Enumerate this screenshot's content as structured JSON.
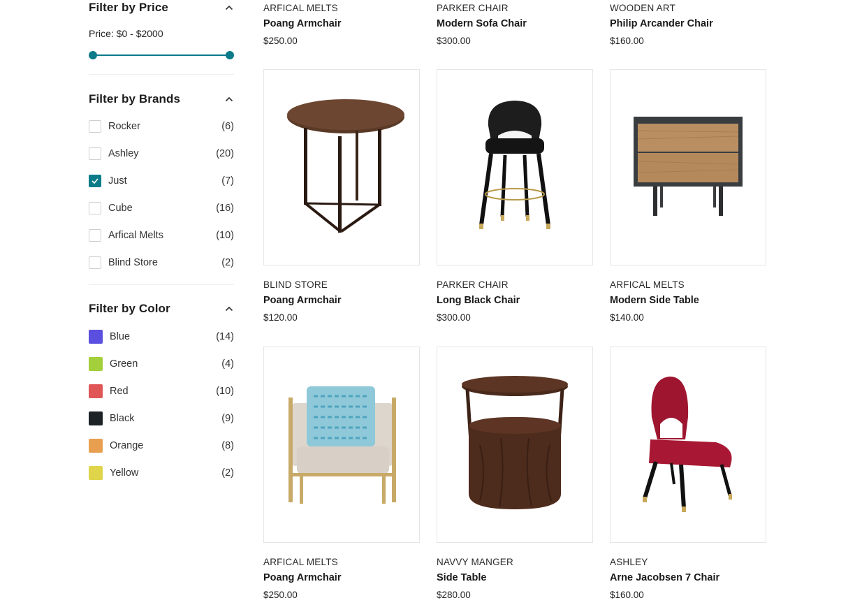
{
  "filters": {
    "price": {
      "title": "Filter by Price",
      "range_text": "Price: $0 - $2000",
      "min": 0,
      "max": 2000,
      "selected_min": 0,
      "selected_max": 2000
    },
    "brands": {
      "title": "Filter by Brands",
      "items": [
        {
          "label": "Rocker",
          "count": "(6)",
          "checked": false
        },
        {
          "label": "Ashley",
          "count": "(20)",
          "checked": false
        },
        {
          "label": "Just",
          "count": "(7)",
          "checked": true
        },
        {
          "label": "Cube",
          "count": "(16)",
          "checked": false
        },
        {
          "label": "Arfical Melts",
          "count": "(10)",
          "checked": false
        },
        {
          "label": "Blind Store",
          "count": "(2)",
          "checked": false
        }
      ]
    },
    "colors": {
      "title": "Filter by Color",
      "items": [
        {
          "label": "Blue",
          "count": "(14)",
          "color": "#5b4fe0"
        },
        {
          "label": "Green",
          "count": "(4)",
          "color": "#a3cf3a"
        },
        {
          "label": "Red",
          "count": "(10)",
          "color": "#e05555"
        },
        {
          "label": "Black",
          "count": "(9)",
          "color": "#1c2226"
        },
        {
          "label": "Orange",
          "count": "(8)",
          "color": "#e8a050"
        },
        {
          "label": "Yellow",
          "count": "(2)",
          "color": "#e0d44a"
        }
      ]
    }
  },
  "products": {
    "top_row": [
      {
        "brand": "ARFICAL MELTS",
        "name": "Poang Armchair",
        "price": "$250.00"
      },
      {
        "brand": "PARKER CHAIR",
        "name": "Modern Sofa Chair",
        "price": "$300.00"
      },
      {
        "brand": "WOODEN ART",
        "name": "Philip Arcander Chair",
        "price": "$160.00"
      }
    ],
    "row1": [
      {
        "brand": "BLIND STORE",
        "name": "Poang Armchair",
        "price": "$120.00",
        "image": "round-side-table"
      },
      {
        "brand": "PARKER CHAIR",
        "name": "Long Black Chair",
        "price": "$300.00",
        "image": "bar-stool"
      },
      {
        "brand": "ARFICAL MELTS",
        "name": "Modern Side Table",
        "price": "$140.00",
        "image": "nightstand"
      }
    ],
    "row2": [
      {
        "brand": "ARFICAL MELTS",
        "name": "Poang Armchair",
        "price": "$250.00",
        "image": "armchair"
      },
      {
        "brand": "NAVVY MANGER",
        "name": "Side Table",
        "price": "$280.00",
        "image": "drum-side-table"
      },
      {
        "brand": "ASHLEY",
        "name": "Arne Jacobsen 7 Chair",
        "price": "$160.00",
        "image": "red-velvet-chair"
      }
    ]
  },
  "colors": {
    "accent": "#0b7b8a"
  }
}
